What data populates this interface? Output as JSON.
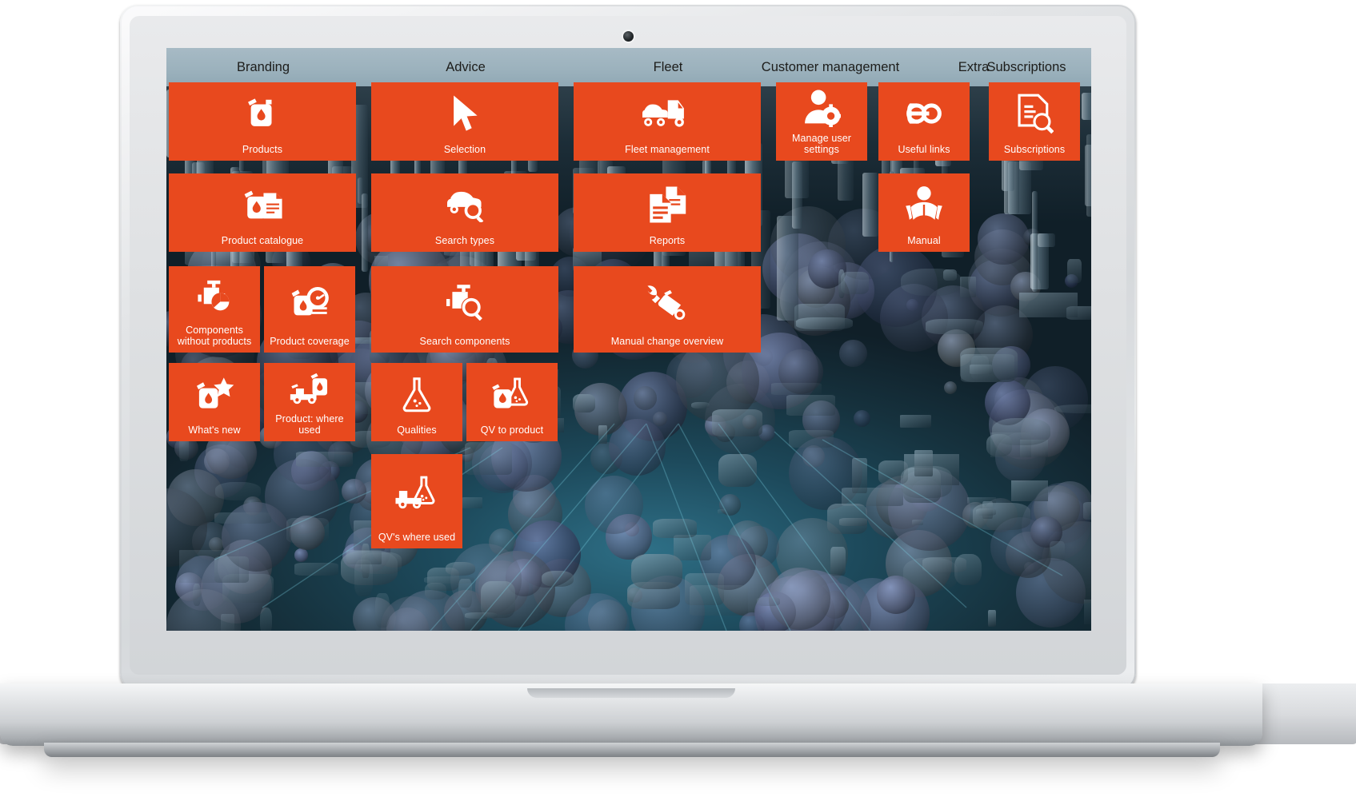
{
  "device": {
    "type": "laptop-mockup"
  },
  "app": {
    "accent_color": "#e8491e",
    "header_text_color": "#1d1d1b",
    "columns": [
      {
        "id": "branding",
        "title": "Branding"
      },
      {
        "id": "advice",
        "title": "Advice"
      },
      {
        "id": "fleet",
        "title": "Fleet"
      },
      {
        "id": "customer-management",
        "title": "Customer management"
      },
      {
        "id": "extra",
        "title": "Extra"
      },
      {
        "id": "subscriptions",
        "title": "Subscriptions"
      }
    ],
    "tiles": [
      {
        "id": "products",
        "label": "Products",
        "icon": "jerrycan-drop-icon",
        "column": "branding"
      },
      {
        "id": "product-catalogue",
        "label": "Product catalogue",
        "icon": "jerrycan-document-icon",
        "column": "branding"
      },
      {
        "id": "components-without-products",
        "label": "Components without products",
        "icon": "engine-pie-icon",
        "column": "branding"
      },
      {
        "id": "product-coverage",
        "label": "Product coverage",
        "icon": "jerrycan-gauge-icon",
        "column": "branding"
      },
      {
        "id": "whats-new",
        "label": "What's new",
        "icon": "jerrycan-star-icon",
        "column": "branding"
      },
      {
        "id": "product-where-used",
        "label": "Product: where used",
        "icon": "truck-jerrycan-icon",
        "column": "branding"
      },
      {
        "id": "selection",
        "label": "Selection",
        "icon": "cursor-arrow-icon",
        "column": "advice"
      },
      {
        "id": "search-types",
        "label": "Search types",
        "icon": "car-search-icon",
        "column": "advice"
      },
      {
        "id": "search-components",
        "label": "Search components",
        "icon": "engine-search-icon",
        "column": "advice"
      },
      {
        "id": "qualities",
        "label": "Qualities",
        "icon": "flask-icon",
        "column": "advice"
      },
      {
        "id": "qv-to-product",
        "label": "QV to product",
        "icon": "jerrycan-flask-icon",
        "column": "advice"
      },
      {
        "id": "qvs-where-used",
        "label": "QV's where used",
        "icon": "truck-flask-icon",
        "column": "advice"
      },
      {
        "id": "fleet-management",
        "label": "Fleet management",
        "icon": "truck-car-icon",
        "column": "fleet"
      },
      {
        "id": "reports",
        "label": "Reports",
        "icon": "documents-icon",
        "column": "fleet"
      },
      {
        "id": "manual-change-overview",
        "label": "Manual change overview",
        "icon": "wrench-jerrycan-icon",
        "column": "fleet"
      },
      {
        "id": "manage-user-settings",
        "label": "Manage user settings",
        "icon": "user-gear-icon",
        "column": "customer-management"
      },
      {
        "id": "useful-links",
        "label": "Useful links",
        "icon": "link-icon",
        "column": "extra"
      },
      {
        "id": "manual",
        "label": "Manual",
        "icon": "person-reading-icon",
        "column": "extra"
      },
      {
        "id": "subscriptions",
        "label": "Subscriptions",
        "icon": "document-search-icon",
        "column": "subscriptions"
      }
    ]
  }
}
